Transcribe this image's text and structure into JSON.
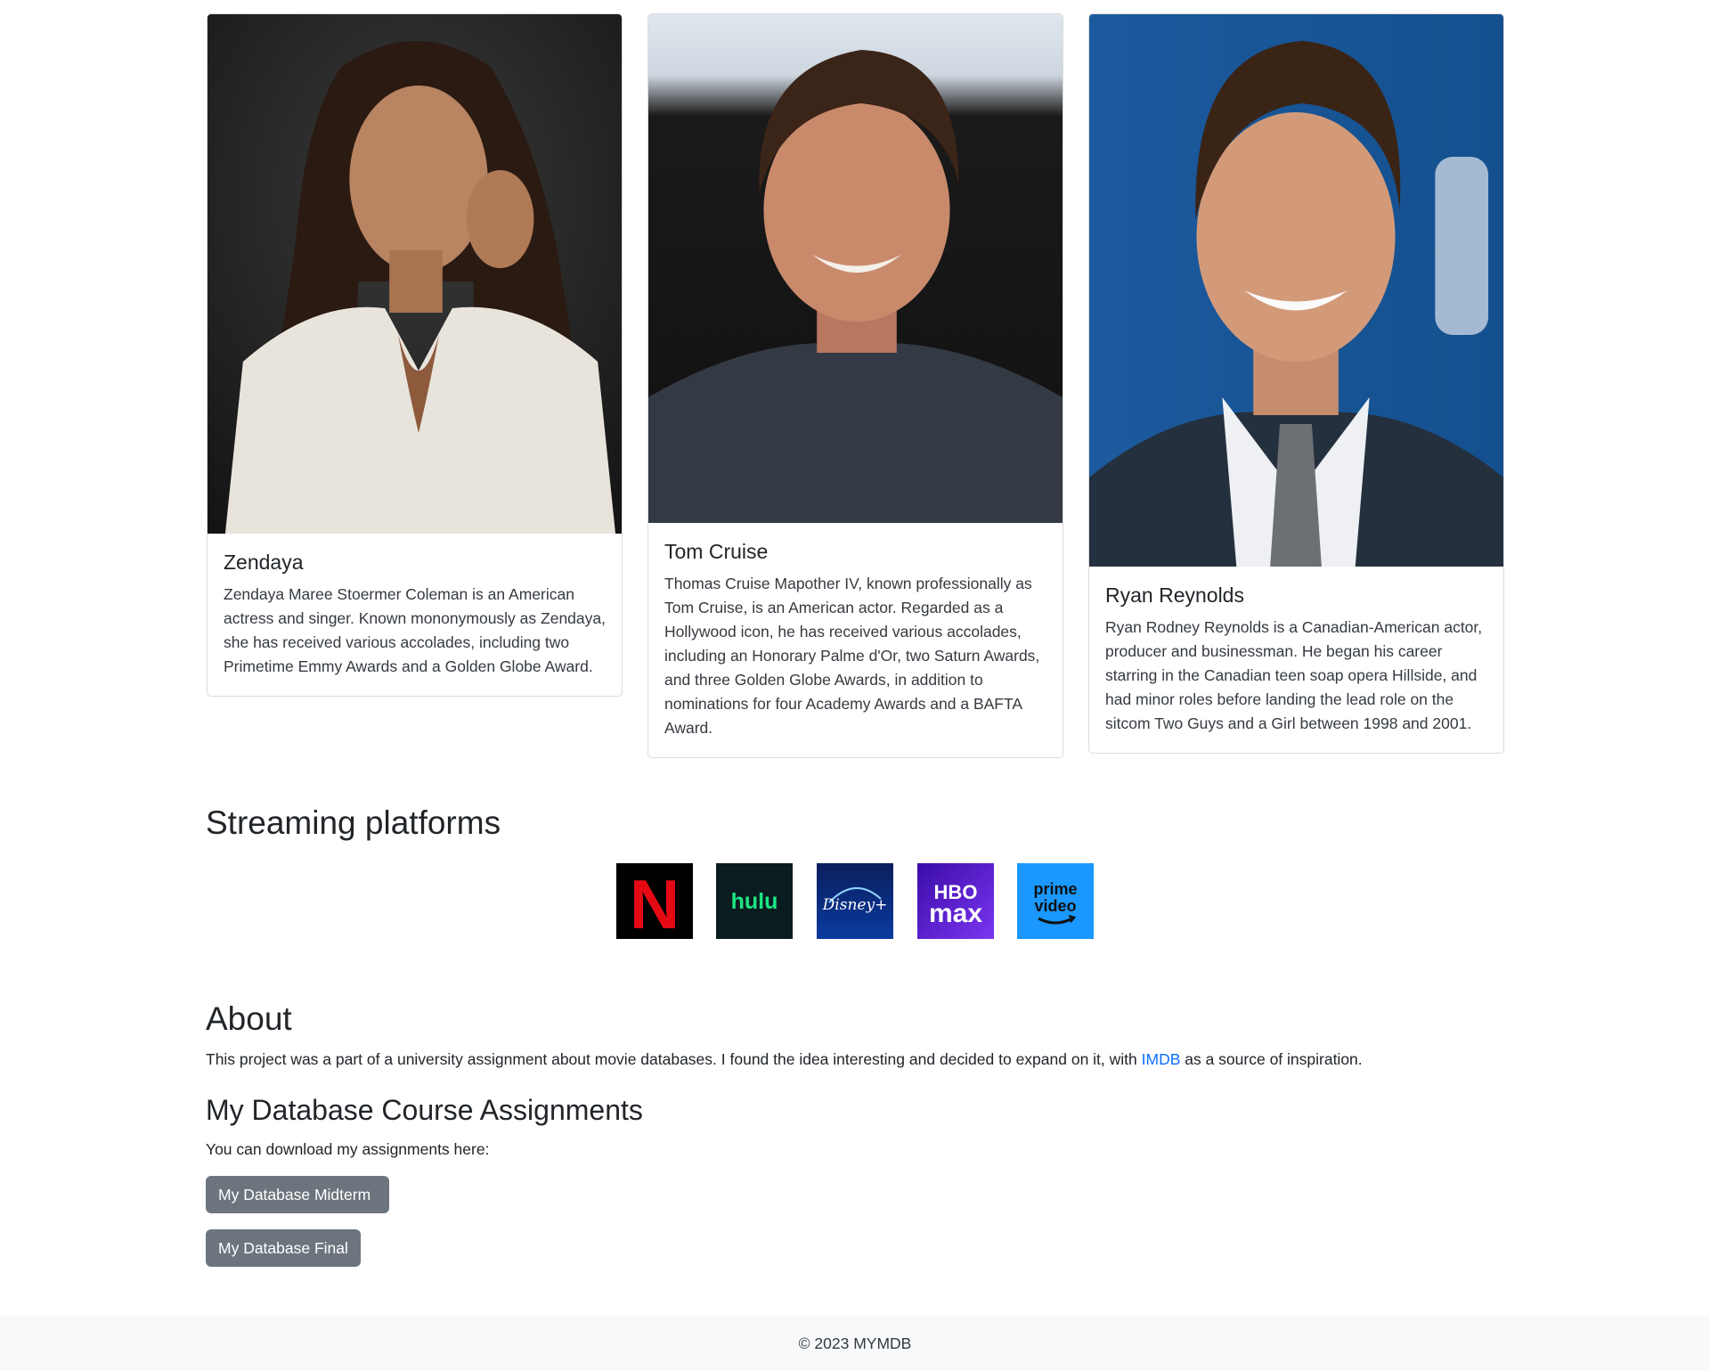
{
  "actors": [
    {
      "name": "Zendaya",
      "bio": "Zendaya Maree Stoermer Coleman is an American actress and singer. Known mononymously as Zendaya, she has received various accolades, including two Primetime Emmy Awards and a Golden Globe Award."
    },
    {
      "name": "Tom Cruise",
      "bio": "Thomas Cruise Mapother IV, known professionally as Tom Cruise, is an American actor. Regarded as a Hollywood icon, he has received various accolades, including an Honorary Palme d'Or, two Saturn Awards, and three Golden Globe Awards, in addition to nominations for four Academy Awards and a BAFTA Award."
    },
    {
      "name": "Ryan Reynolds",
      "bio": "Ryan Rodney Reynolds is a Canadian-American actor, producer and businessman. He began his career starring in the Canadian teen soap opera Hillside, and had minor roles before landing the lead role on the sitcom Two Guys and a Girl between 1998 and 2001."
    }
  ],
  "streaming": {
    "heading": "Streaming platforms",
    "platforms": [
      {
        "label": "N",
        "icon": "netflix-logo",
        "bg": "#000000",
        "fg": "#e50914"
      },
      {
        "label": "hulu",
        "icon": "hulu-logo",
        "bg": "#0b1c20",
        "fg": "#1ce783"
      },
      {
        "label": "Disney+",
        "icon": "disney-plus-logo",
        "bg": "#0a2a7a",
        "fg": "#ffffff"
      },
      {
        "label_top": "HBO",
        "label_bottom": "max",
        "icon": "hbo-max-logo",
        "bg": "#5a16d8",
        "fg": "#ffffff"
      },
      {
        "label_top": "prime",
        "label_bottom": "video",
        "icon": "prime-video-logo",
        "bg": "#1a98ff",
        "fg": "#0f1111"
      }
    ]
  },
  "about": {
    "heading": "About",
    "text_before": "This project was a part of a university assignment about movie databases. I found the idea interesting and decided to expand on it, with ",
    "link": "IMDB",
    "text_after": " as a source of inspiration."
  },
  "assignments": {
    "heading": "My Database Course Assignments",
    "intro": "You can download my assignments here:",
    "midterm": "My Database Midterm",
    "final": "My Database Final"
  },
  "footer": {
    "text": "© 2023 MYMDB"
  }
}
